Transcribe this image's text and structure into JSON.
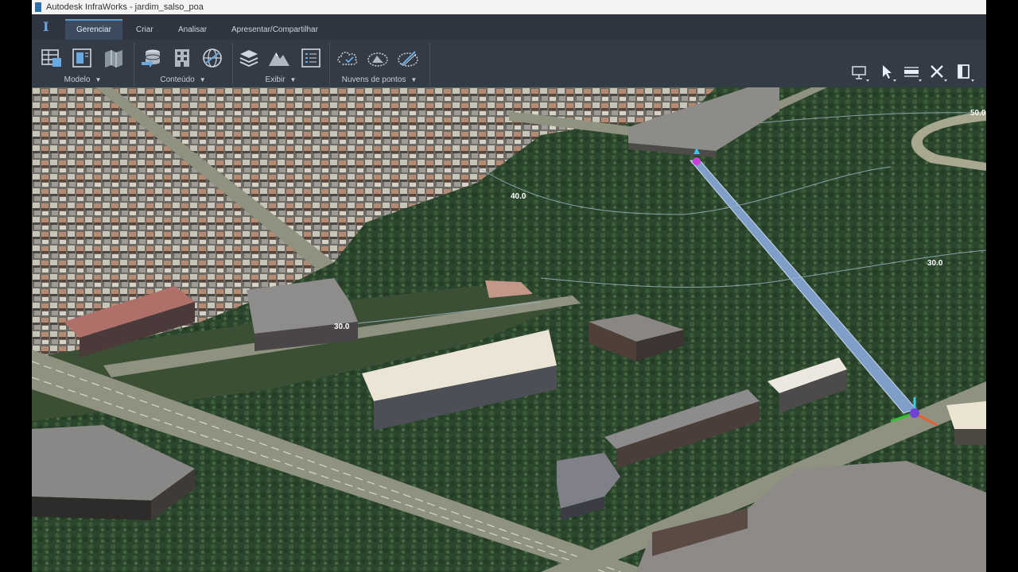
{
  "window": {
    "title": "Autodesk InfraWorks - jardim_salso_poa"
  },
  "tabs": [
    {
      "label": "Gerenciar",
      "active": true
    },
    {
      "label": "Criar",
      "active": false
    },
    {
      "label": "Analisar",
      "active": false
    },
    {
      "label": "Apresentar/Compartilhar",
      "active": false
    }
  ],
  "ribbon": {
    "groups": [
      {
        "label": "Modelo",
        "icons": [
          "model-table-icon",
          "model-panel-icon",
          "model-map-icon"
        ]
      },
      {
        "label": "Conteúdo",
        "icons": [
          "data-sources-icon",
          "building-grid-icon",
          "globe-icon"
        ]
      },
      {
        "label": "Exibir",
        "icons": [
          "layers-icon",
          "terrain-icon",
          "list-panel-icon"
        ]
      },
      {
        "label": "Nuvens de pontos",
        "icons": [
          "point-cloud-icon",
          "point-cloud-terrain-icon",
          "point-cloud-edit-icon"
        ]
      }
    ],
    "right_tools": [
      "presentation-icon",
      "select-arrow-icon",
      "measure-icon",
      "close-cross-icon",
      "panel-icon"
    ]
  },
  "viewport": {
    "contour_labels": [
      "50.0",
      "40.0",
      "30.0",
      "30.0"
    ]
  },
  "colors": {
    "accent": "#4f9ad8",
    "ribbon_bg": "#333b47",
    "tab_bg": "#2e3440",
    "vegetation": "#2f4a30",
    "road": "#8f927f"
  }
}
